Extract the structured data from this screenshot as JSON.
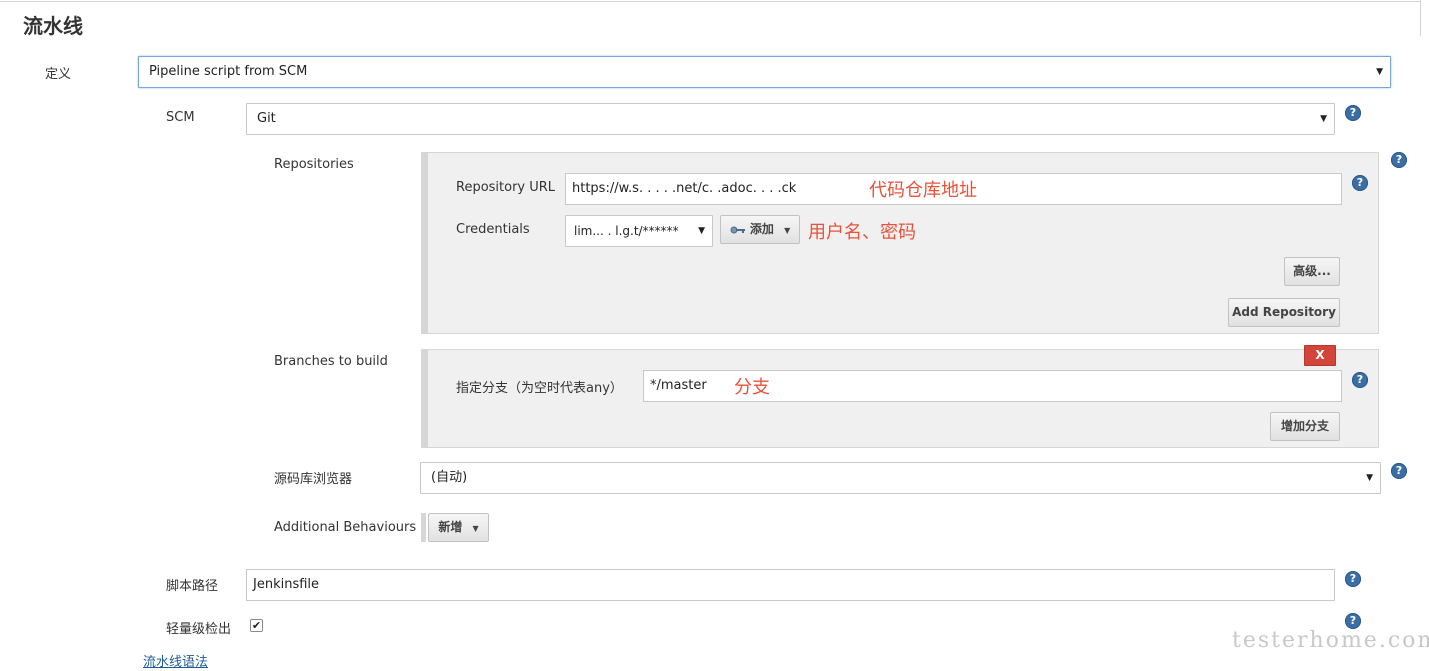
{
  "section_title": "流水线",
  "definition": {
    "label": "定义",
    "selected": "Pipeline script from SCM"
  },
  "scm": {
    "label": "SCM",
    "selected": "Git"
  },
  "repositories": {
    "label": "Repositories",
    "url_label": "Repository URL",
    "url_value": "https://w.s.       .   .  .  .net/c.  .adoc. . .   .ck",
    "credentials_label": "Credentials",
    "credentials_value": "lim...   . l.g.t/******",
    "add_button": "添加",
    "advanced_button": "高级...",
    "add_repository_button": "Add Repository"
  },
  "branches": {
    "label": "Branches to build",
    "delete_button": "X",
    "specifier_label": "指定分支（为空时代表any）",
    "specifier_value": "*/master",
    "add_branch_button": "增加分支"
  },
  "browser": {
    "label": "源码库浏览器",
    "selected": "(自动)"
  },
  "additional": {
    "label": "Additional Behaviours",
    "add_button": "新增"
  },
  "script_path": {
    "label": "脚本路径",
    "value": "Jenkinsfile"
  },
  "lightweight": {
    "label": "轻量级检出",
    "checked": true,
    "check_glyph": "✔"
  },
  "syntax_link": "流水线语法",
  "annotations": {
    "repo_url": "代码仓库地址",
    "credentials": "用户名、密码",
    "branch": "分支"
  },
  "help_glyph": "?",
  "caret_glyph": "▼",
  "watermark": "testerhome.com",
  "colors": {
    "annotation": "#e8523b",
    "help": "#3a6ea5",
    "delete": "#d2453a",
    "link": "#1f5c99"
  }
}
